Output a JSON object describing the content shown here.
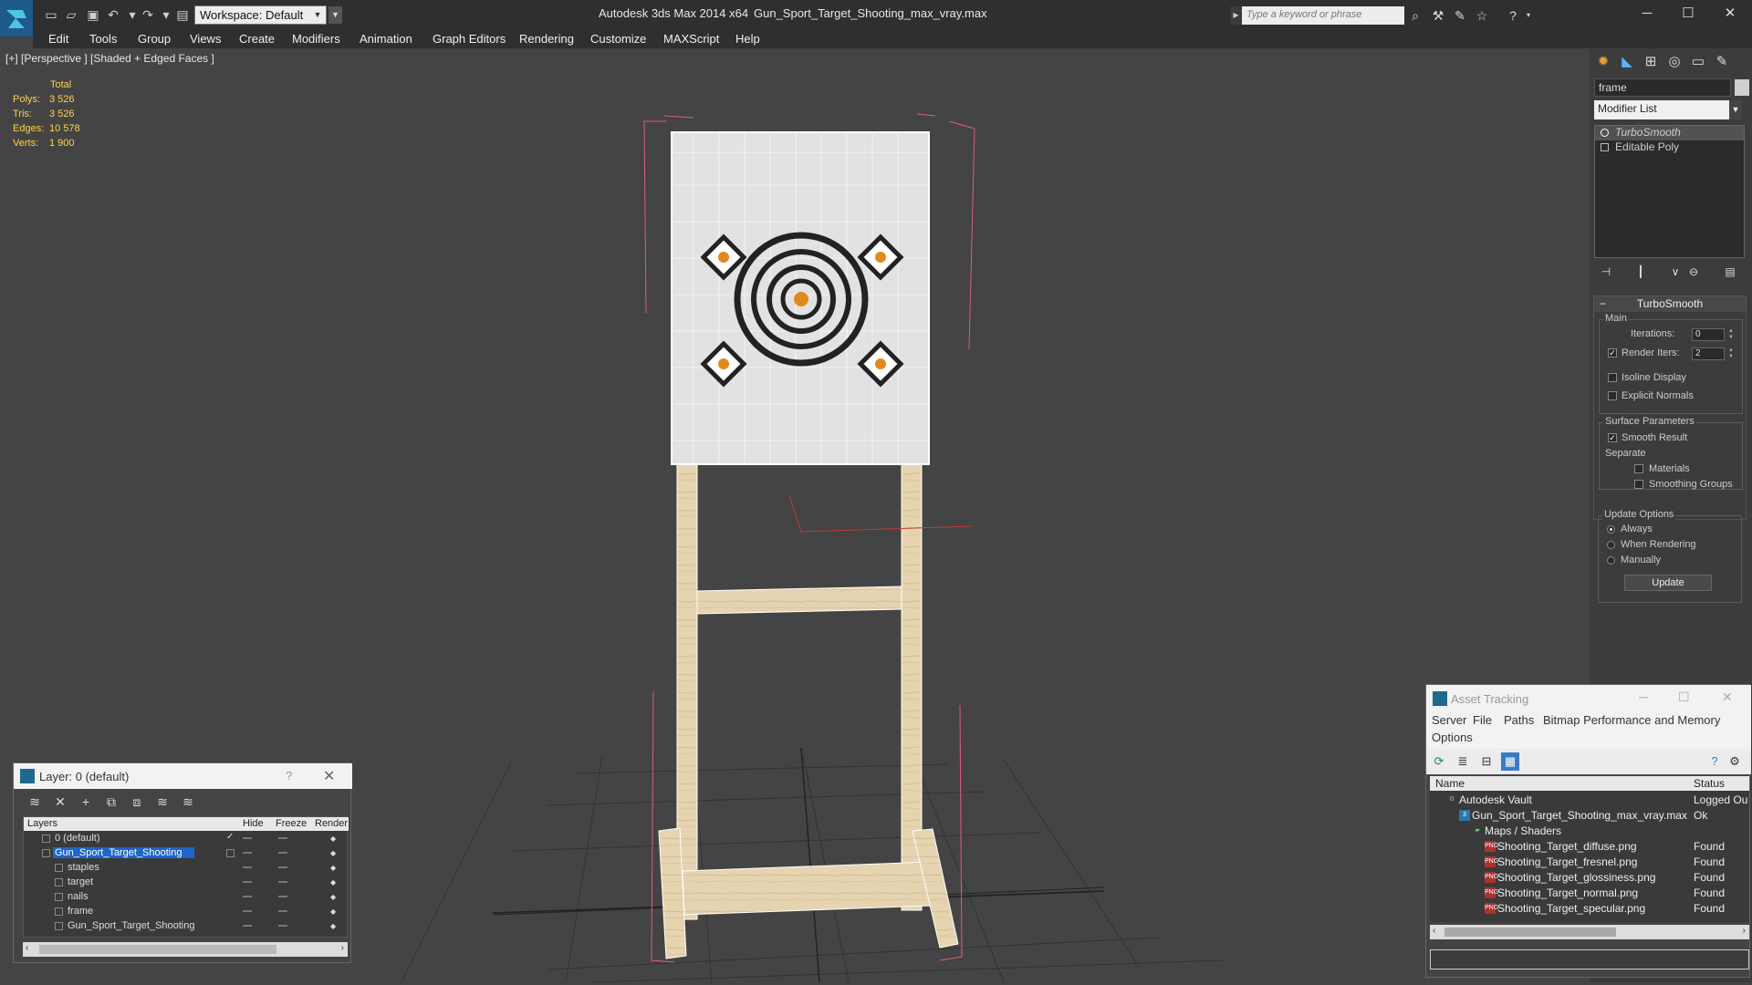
{
  "app": {
    "title": "Autodesk 3ds Max  2014 x64",
    "file_name": "Gun_Sport_Target_Shooting_max_vray.max",
    "workspace_label": "Workspace: Default",
    "search_placeholder": "Type a keyword or phrase"
  },
  "menu": [
    "Edit",
    "Tools",
    "Group",
    "Views",
    "Create",
    "Modifiers",
    "Animation",
    "Graph Editors",
    "Rendering",
    "Customize",
    "MAXScript",
    "Help"
  ],
  "viewport": {
    "label": "[+] [Perspective ] [Shaded + Edged Faces ]",
    "stats": {
      "header": "Total",
      "rows": [
        {
          "key": "Polys:",
          "value": "3 526"
        },
        {
          "key": "Tris:",
          "value": "3 526"
        },
        {
          "key": "Edges:",
          "value": "10 578"
        },
        {
          "key": "Verts:",
          "value": "1 900"
        }
      ]
    }
  },
  "command_panel": {
    "object_name": "frame",
    "modifier_list": "Modifier List",
    "stack": [
      "TurboSmooth",
      "Editable Poly"
    ],
    "rollout_title": "TurboSmooth",
    "main_group": "Main",
    "iterations_label": "Iterations:",
    "iterations_value": "0",
    "render_iters_label": "Render Iters:",
    "render_iters_value": "2",
    "isoline_label": "Isoline Display",
    "explicit_normals_label": "Explicit Normals",
    "surface_group": "Surface Parameters",
    "smooth_result_label": "Smooth Result",
    "separate_label": "Separate",
    "materials_label": "Materials",
    "smoothing_groups_label": "Smoothing Groups",
    "update_group": "Update Options",
    "always_label": "Always",
    "when_rendering_label": "When Rendering",
    "manually_label": "Manually",
    "update_button": "Update"
  },
  "layer_window": {
    "title": "Layer: 0 (default)",
    "help": "?",
    "columns": {
      "layers": "Layers",
      "hide": "Hide",
      "freeze": "Freeze",
      "render": "Render"
    },
    "rows": [
      {
        "name": "0 (default)"
      },
      {
        "name": "Gun_Sport_Target_Shooting"
      },
      {
        "name": "staples"
      },
      {
        "name": "target"
      },
      {
        "name": "nails"
      },
      {
        "name": "frame"
      },
      {
        "name": "Gun_Sport_Target_Shooting"
      }
    ]
  },
  "asset_window": {
    "title": "Asset Tracking",
    "menu": [
      "Server",
      "File",
      "Paths",
      "Bitmap Performance and Memory",
      "Options"
    ],
    "columns": {
      "name": "Name",
      "status": "Status"
    },
    "rows": [
      {
        "name": "Autodesk Vault",
        "status": "Logged Ou"
      },
      {
        "name": "Gun_Sport_Target_Shooting_max_vray.max",
        "status": "Ok"
      },
      {
        "name": "Maps / Shaders",
        "status": ""
      },
      {
        "name": "Shooting_Target_diffuse.png",
        "status": "Found"
      },
      {
        "name": "Shooting_Target_fresnel.png",
        "status": "Found"
      },
      {
        "name": "Shooting_Target_glossiness.png",
        "status": "Found"
      },
      {
        "name": "Shooting_Target_normal.png",
        "status": "Found"
      },
      {
        "name": "Shooting_Target_specular.png",
        "status": "Found"
      }
    ]
  }
}
